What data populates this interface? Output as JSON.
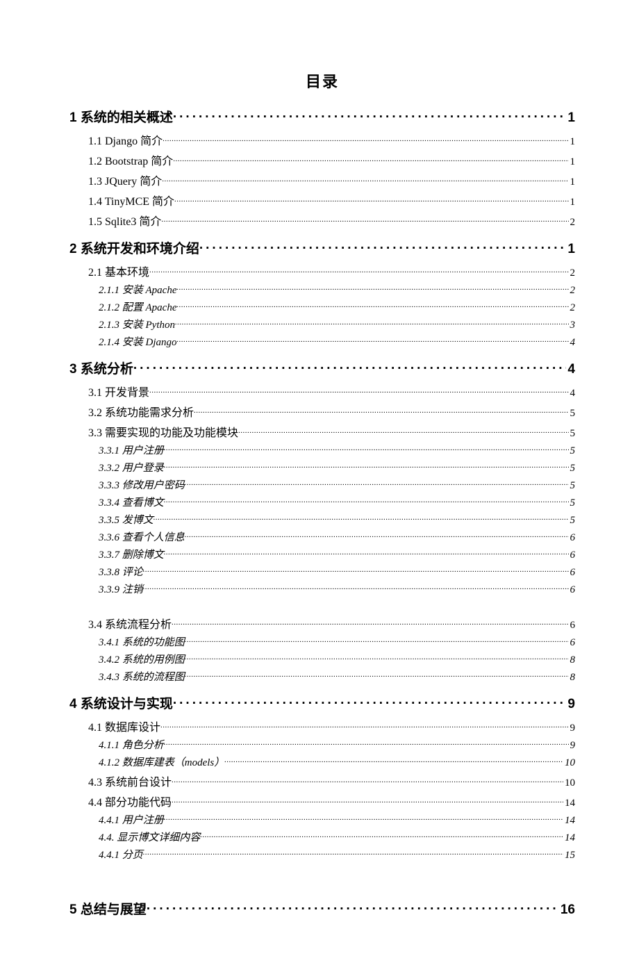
{
  "title": "目录",
  "entries": [
    {
      "level": "h1",
      "label": "1 系统的相关概述",
      "page": "1"
    },
    {
      "level": "2",
      "label": "1.1 Django 简介",
      "page": "1"
    },
    {
      "level": "2",
      "label": "1.2 Bootstrap 简介",
      "page": "1"
    },
    {
      "level": "2",
      "label": "1.3 JQuery 简介",
      "page": "1"
    },
    {
      "level": "2",
      "label": "1.4 TinyMCE 简介",
      "page": "1"
    },
    {
      "level": "2",
      "label": "1.5 Sqlite3 简介",
      "page": "2"
    },
    {
      "level": "h1",
      "label": "2 系统开发和环境介绍",
      "page": "1"
    },
    {
      "level": "2",
      "label": "2.1 基本环境",
      "page": "2"
    },
    {
      "level": "3",
      "label": "2.1.1 安装 Apache",
      "page": "2"
    },
    {
      "level": "3",
      "label": "2.1.2 配置 Apache",
      "page": "2"
    },
    {
      "level": "3",
      "label": "2.1.3 安装 Python",
      "page": "3"
    },
    {
      "level": "3",
      "label": "2.1.4 安装 Django",
      "page": "4"
    },
    {
      "level": "h1",
      "label": "3 系统分析",
      "page": "4"
    },
    {
      "level": "2",
      "label": "3.1 开发背景",
      "page": "4"
    },
    {
      "level": "2",
      "label": "3.2 系统功能需求分析",
      "page": "5"
    },
    {
      "level": "2",
      "label": "3.3 需要实现的功能及功能模块",
      "page": "5"
    },
    {
      "level": "3",
      "label": "3.3.1 用户注册",
      "page": "5"
    },
    {
      "level": "3",
      "label": "3.3.2 用户登录",
      "page": "5"
    },
    {
      "level": "3",
      "label": "3.3.3 修改用户密码",
      "page": "5"
    },
    {
      "level": "3",
      "label": "3.3.4 查看博文",
      "page": "5"
    },
    {
      "level": "3",
      "label": "3.3.5 发博文",
      "page": "5"
    },
    {
      "level": "3",
      "label": "3.3.6 查看个人信息",
      "page": "6"
    },
    {
      "level": "3",
      "label": "3.3.7 删除博文",
      "page": "6"
    },
    {
      "level": "3",
      "label": "3.3.8 评论",
      "page": "6"
    },
    {
      "level": "3",
      "label": "3.3.9 注销",
      "page": "6"
    },
    {
      "gap": "sm"
    },
    {
      "level": "2",
      "label": "3.4 系统流程分析",
      "page": "6"
    },
    {
      "level": "3",
      "label": "3.4.1 系统的功能图",
      "page": "6"
    },
    {
      "level": "3",
      "label": "3.4.2 系统的用例图",
      "page": "8"
    },
    {
      "level": "3",
      "label": "3.4.3 系统的流程图",
      "page": "8"
    },
    {
      "level": "h1",
      "label": "4 系统设计与实现",
      "page": "9"
    },
    {
      "level": "2",
      "label": "4.1 数据库设计",
      "page": "9"
    },
    {
      "level": "3",
      "label": "4.1.1 角色分析",
      "page": "9"
    },
    {
      "level": "3",
      "label": "4.1.2 数据库建表（models）",
      "page": "10"
    },
    {
      "level": "2",
      "label": "4.3 系统前台设计",
      "page": "10"
    },
    {
      "level": "2",
      "label": "4.4 部分功能代码",
      "page": "14"
    },
    {
      "level": "3",
      "label": "4.4.1 用户注册",
      "page": "14"
    },
    {
      "level": "3",
      "label": "4.4. 显示博文详细内容",
      "page": "14"
    },
    {
      "level": "3",
      "label": "4.4.1 分页",
      "page": "15"
    },
    {
      "gap": "lg"
    },
    {
      "level": "h1",
      "label": "5 总结与展望",
      "page": "16"
    }
  ]
}
